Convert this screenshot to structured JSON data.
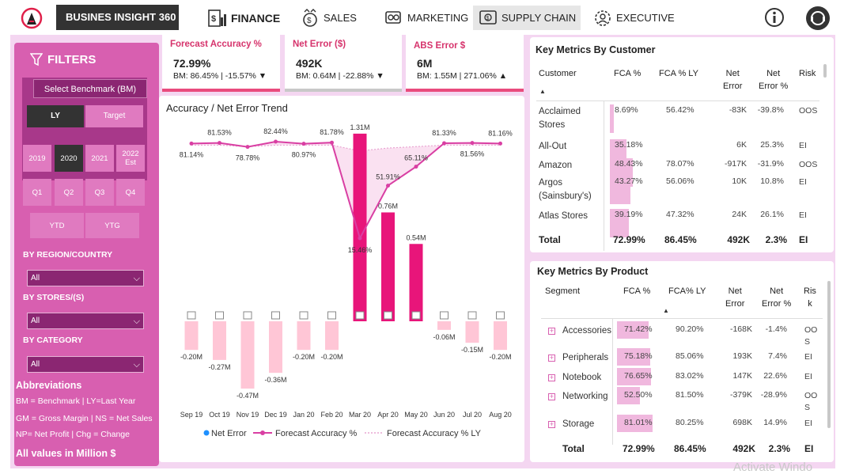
{
  "nav": {
    "brand": "BUSINES INSIGHT 360",
    "items": [
      {
        "label": "FINANCE",
        "icon": "finance-icon",
        "active": true
      },
      {
        "label": "SALES",
        "icon": "sales-icon",
        "active": false
      },
      {
        "label": "MARKETING",
        "icon": "marketing-icon",
        "active": false
      },
      {
        "label": "SUPPLY CHAIN",
        "icon": "supply-chain-icon",
        "active": false
      },
      {
        "label": "EXECUTIVE",
        "icon": "executive-icon",
        "active": false
      }
    ],
    "right_icons": [
      "info-icon",
      "support-icon"
    ]
  },
  "filters": {
    "title": "FILTERS",
    "benchmark_label": "Select Benchmark (BM)",
    "benchmark_options": [
      "LY",
      "Target"
    ],
    "benchmark_selected": "LY",
    "years": [
      "2019",
      "2020",
      "2021",
      "2022\nEst"
    ],
    "year_selected": "2020",
    "quarters": [
      "Q1",
      "Q2",
      "Q3",
      "Q4"
    ],
    "periods": [
      "YTD",
      "YTG"
    ],
    "region_label": "BY REGION/COUNTRY",
    "region_value": "All",
    "stores_label": "BY STORES/(S)",
    "stores_value": "All",
    "category_label": "BY CATEGORY",
    "category_value": "All",
    "abbr_title": "Abbreviations",
    "abbr_lines": [
      "BM = Benchmark | LY=Last Year",
      "GM = Gross Margin | NS = Net Sales",
      "NP= Net Profit | Chg = Change"
    ],
    "all_values": "All values in Million $"
  },
  "kpis": [
    {
      "title": "Forecast Accuracy %",
      "value": "72.99%",
      "sub": "BM: 86.45% | -15.57%",
      "arrow": "▼",
      "border": "#e94b7d"
    },
    {
      "title": "Net Error ($)",
      "value": "492K",
      "sub": "BM: 0.64M | -22.88%",
      "arrow": "▼",
      "border": "#c8c8c8"
    },
    {
      "title": "ABS Error $",
      "value": "6M",
      "sub": "BM: 1.55M | 271.06%",
      "arrow": "▲",
      "border": "#e94b7d"
    }
  ],
  "chart_data": {
    "type": "line",
    "title": "Accuracy / Net Error Trend",
    "categories": [
      "Sep 19",
      "Oct 19",
      "Nov 19",
      "Dec 19",
      "Jan 20",
      "Feb 20",
      "Mar 20",
      "Apr 20",
      "May 20",
      "Jun 20",
      "Jul 20",
      "Aug 20"
    ],
    "series": [
      {
        "name": "Net Error",
        "kind": "bar",
        "values": [
          -0.2,
          -0.27,
          -0.47,
          -0.36,
          -0.2,
          -0.2,
          1.31,
          0.76,
          0.54,
          -0.06,
          -0.15,
          -0.2
        ],
        "labels": [
          "-0.20M",
          "-0.27M",
          "-0.47M",
          "-0.36M",
          "-0.20M",
          "-0.20M",
          "1.31M",
          "0.76M",
          "0.54M",
          "-0.06M",
          "-0.15M",
          "-0.20M"
        ],
        "color_pos": "#e8157a",
        "color_neg": "#ffc6d6"
      },
      {
        "name": "Forecast Accuracy %",
        "kind": "line",
        "values": [
          81.14,
          81.53,
          78.78,
          82.44,
          80.97,
          81.78,
          15.46,
          51.91,
          65.11,
          81.33,
          81.56,
          81.16
        ],
        "labels": [
          "81.14%",
          "81.53%",
          "78.78%",
          "82.44%",
          "80.97%",
          "81.78%",
          "15.46%",
          "51.91%",
          "65.11%",
          "81.33%",
          "81.56%",
          "81.16%"
        ],
        "color": "#d93fa3"
      },
      {
        "name": "Forecast Accuracy % LY",
        "kind": "area",
        "values": [
          80,
          80,
          79,
          80,
          80,
          80,
          76,
          78,
          79,
          80,
          80,
          80
        ],
        "color": "#f6cde8"
      }
    ],
    "legend_position": "bottom"
  },
  "customer_table": {
    "title": "Key Metrics By Customer",
    "headers": [
      "Customer",
      "FCA %",
      "FCA % LY",
      "Net\nError",
      "Net\nError %",
      "Risk"
    ],
    "rows": [
      {
        "name": "Acclaimed\nStores",
        "fca": "8.69%",
        "fca_v": 8.69,
        "fca_ly": "56.42%",
        "net": "-83K",
        "net_pct": "-39.8%",
        "risk": "OOS"
      },
      {
        "name": "All-Out",
        "fca": "35.18%",
        "fca_v": 35.18,
        "fca_ly": "",
        "net": "6K",
        "net_pct": "25.3%",
        "risk": "EI"
      },
      {
        "name": "Amazon",
        "fca": "48.43%",
        "fca_v": 48.43,
        "fca_ly": "78.07%",
        "net": "-917K",
        "net_pct": "-31.9%",
        "risk": "OOS"
      },
      {
        "name": "Argos\n(Sainsbury's)",
        "fca": "43.27%",
        "fca_v": 43.27,
        "fca_ly": "56.06%",
        "net": "10K",
        "net_pct": "10.8%",
        "risk": "EI"
      },
      {
        "name": "Atlas Stores",
        "fca": "39.19%",
        "fca_v": 39.19,
        "fca_ly": "47.32%",
        "net": "24K",
        "net_pct": "26.1%",
        "risk": "EI"
      }
    ],
    "total": {
      "name": "Total",
      "fca": "72.99%",
      "fca_ly": "86.45%",
      "net": "492K",
      "net_pct": "2.3%",
      "risk": "EI"
    }
  },
  "product_table": {
    "title": "Key Metrics By Product",
    "headers": [
      "Segment",
      "FCA %",
      "FCA% LY",
      "Net\nError",
      "Net\nError %",
      "Ris\nk"
    ],
    "rows": [
      {
        "name": "Accessories",
        "fca": "71.42%",
        "fca_v": 71.42,
        "fca_ly": "90.20%",
        "net": "-168K",
        "net_pct": "-1.4%",
        "risk": "OO\nS"
      },
      {
        "name": "Peripherals",
        "fca": "75.18%",
        "fca_v": 75.18,
        "fca_ly": "85.06%",
        "net": "193K",
        "net_pct": "7.4%",
        "risk": "EI"
      },
      {
        "name": "Notebook",
        "fca": "76.65%",
        "fca_v": 76.65,
        "fca_ly": "83.02%",
        "net": "147K",
        "net_pct": "22.6%",
        "risk": "EI"
      },
      {
        "name": "Networking",
        "fca": "52.50%",
        "fca_v": 52.5,
        "fca_ly": "81.50%",
        "net": "-379K",
        "net_pct": "-28.9%",
        "risk": "OO\nS"
      },
      {
        "name": "Storage",
        "fca": "81.01%",
        "fca_v": 81.01,
        "fca_ly": "80.25%",
        "net": "698K",
        "net_pct": "14.9%",
        "risk": "EI"
      }
    ],
    "total": {
      "name": "Total",
      "fca": "72.99%",
      "fca_ly": "86.45%",
      "net": "492K",
      "net_pct": "2.3%",
      "risk": "EI"
    }
  },
  "watermark": "Activate Windo"
}
